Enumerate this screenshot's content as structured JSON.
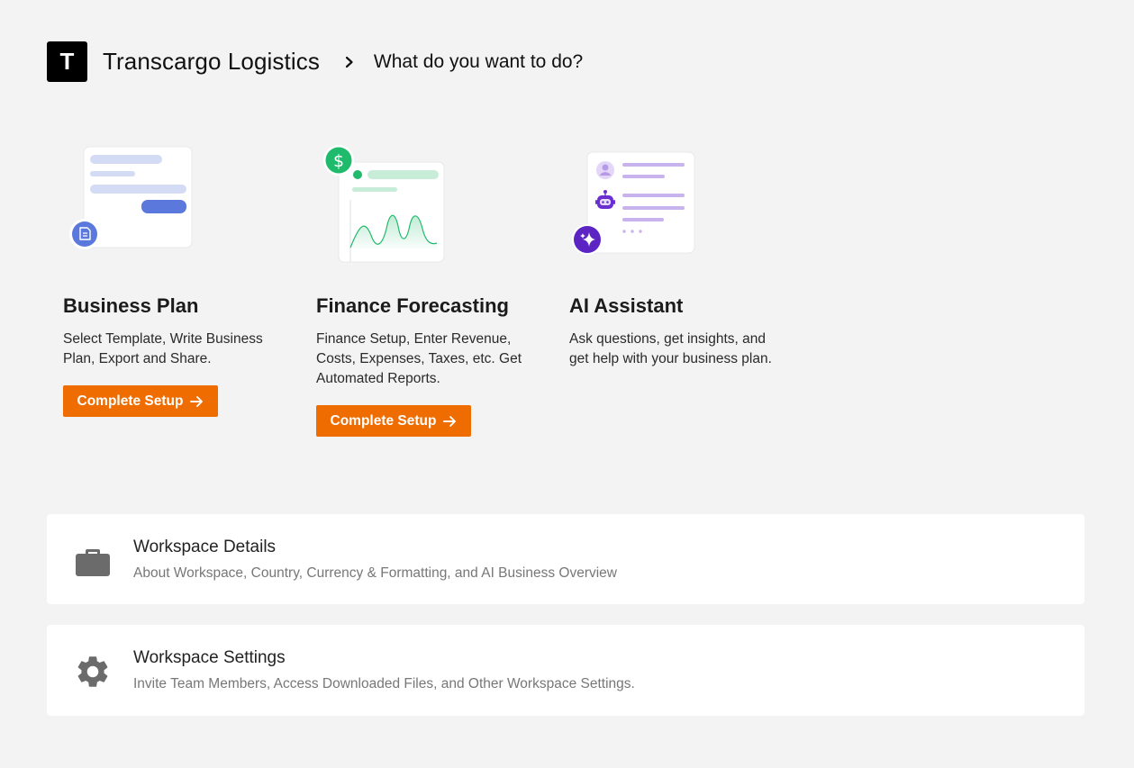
{
  "header": {
    "logo_letter": "T",
    "company": "Transcargo Logistics",
    "page_title": "What do you want to do?"
  },
  "cards": [
    {
      "title": "Business Plan",
      "description": "Select Template, Write Business Plan, Export and Share.",
      "button_label": "Complete Setup"
    },
    {
      "title": "Finance Forecasting",
      "description": "Finance Setup, Enter Revenue, Costs, Expenses, Taxes, etc. Get Automated Reports.",
      "button_label": "Complete Setup"
    },
    {
      "title": "AI Assistant",
      "description": "Ask questions, get insights, and get help with your business plan."
    }
  ],
  "workspace": {
    "details": {
      "title": "Workspace Details",
      "description": "About Workspace, Country, Currency & Formatting, and AI Business Overview"
    },
    "settings": {
      "title": "Workspace Settings",
      "description": "Invite Team Members, Access Downloaded Files, and Other Workspace Settings."
    }
  },
  "icons": {
    "crumb": "chevron-right-icon",
    "details": "briefcase-icon",
    "settings": "gear-icon",
    "button": "arrow-right-icon"
  },
  "colors": {
    "accent": "#ef6c00",
    "background": "#f2f3f2",
    "finance_green": "#1fba6b",
    "ai_purple": "#6a2fd1",
    "plan_blue": "#5b78dc"
  }
}
